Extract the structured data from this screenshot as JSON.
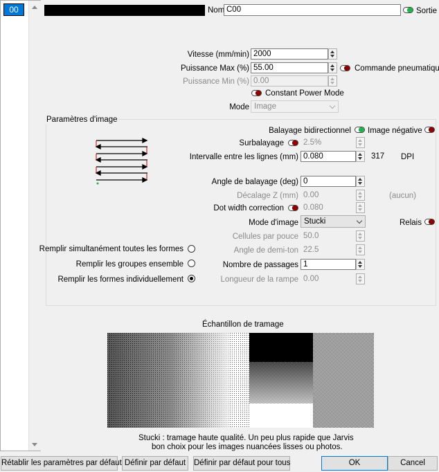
{
  "layer_list": {
    "selected_label": "00"
  },
  "header": {
    "name_label": "Nom",
    "name_value": "C00",
    "color_hex": "#000000",
    "output_label": "Sortie",
    "output_on": true
  },
  "cut": {
    "speed_label": "Vitesse (mm/min)",
    "speed_value": "2000",
    "power_max_label": "Puissance Max (%)",
    "power_max_value": "55.00",
    "air_assist_label": "Commande pneumatique",
    "power_min_label": "Puissance Min (%)",
    "power_min_value": "0.00",
    "constant_power_label": "Constant Power Mode",
    "mode_label": "Mode",
    "mode_value": "Image"
  },
  "image_params": {
    "group_title": "Paramètres d'image",
    "bidir_label": "Balayage bidirectionnel",
    "negative_label": "Image négative",
    "overscan_label": "Surbalayage",
    "overscan_value": "2.5%",
    "line_interval_label": "Intervalle entre les lignes (mm)",
    "line_interval_value": "0.080",
    "dpi_value": "317",
    "dpi_label": "DPI",
    "scan_angle_label": "Angle de balayage (deg)",
    "scan_angle_value": "0",
    "z_offset_label": "Décalage Z (mm)",
    "z_offset_value": "0.00",
    "z_offset_note": "(aucun)",
    "dot_width_label": "Dot width correction",
    "dot_width_value": "0.080",
    "image_mode_label": "Mode d'image",
    "image_mode_value": "Stucki",
    "relief_label": "Relais",
    "cells_label": "Cellules par pouce",
    "cells_value": "50.0",
    "halftone_angle_label": "Angle de demi-ton",
    "halftone_angle_value": "22.5",
    "passes_label": "Nombre de passages",
    "passes_value": "1",
    "ramp_label": "Longueur de la rampe",
    "ramp_value": "0.00",
    "fill_options": [
      {
        "label": "Remplir simultanément toutes les formes",
        "selected": false
      },
      {
        "label": "Remplir les groupes ensemble",
        "selected": false
      },
      {
        "label": "Remplir les formes individuellement",
        "selected": true
      }
    ]
  },
  "dither": {
    "title": "Échantillon de tramage",
    "desc_line1": "Stucki : tramage haute qualité. Un peu plus rapide que Jarvis",
    "desc_line2": "bon choix pour les images nuancées lisses ou photos."
  },
  "footer": {
    "reset_label": "Rétablir les paramètres par défaut",
    "set_default_label": "Définir par défaut",
    "set_default_all_label": "Définir par défaut pour tous",
    "ok_label": "OK",
    "cancel_label": "Cancel"
  }
}
